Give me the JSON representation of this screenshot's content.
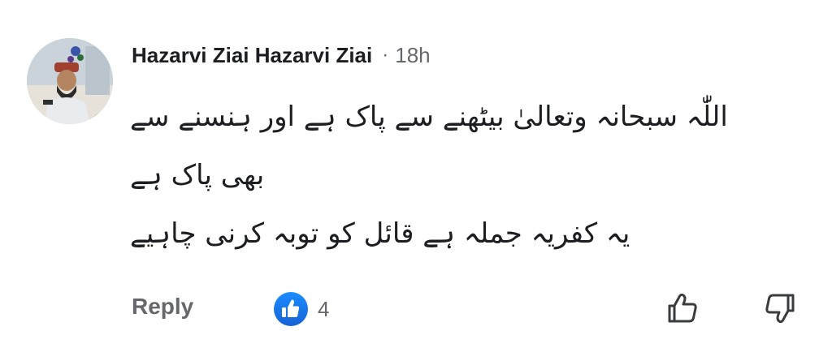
{
  "comment": {
    "author": "Hazarvi Ziai Hazarvi Ziai",
    "separator": "·",
    "time": "18h",
    "lines": [
      "اللّٰہ سبحانہ وتعالیٰ بیٹھنے سے پاک ہے اور ہنسنے سے",
      "بھی پاک ہے",
      "یہ کفریہ جملہ ہے قائل کو توبہ کرنی چاہیے"
    ]
  },
  "actions": {
    "reply_label": "Reply",
    "like_count": "4",
    "like_icon": "thumbs-up-icon",
    "upvote_icon": "thumbs-up-outline-icon",
    "downvote_icon": "thumbs-down-outline-icon"
  },
  "colors": {
    "text": "#1c1e21",
    "secondary": "#65676b",
    "like_blue": "#1877f2",
    "background": "#ffffff"
  }
}
